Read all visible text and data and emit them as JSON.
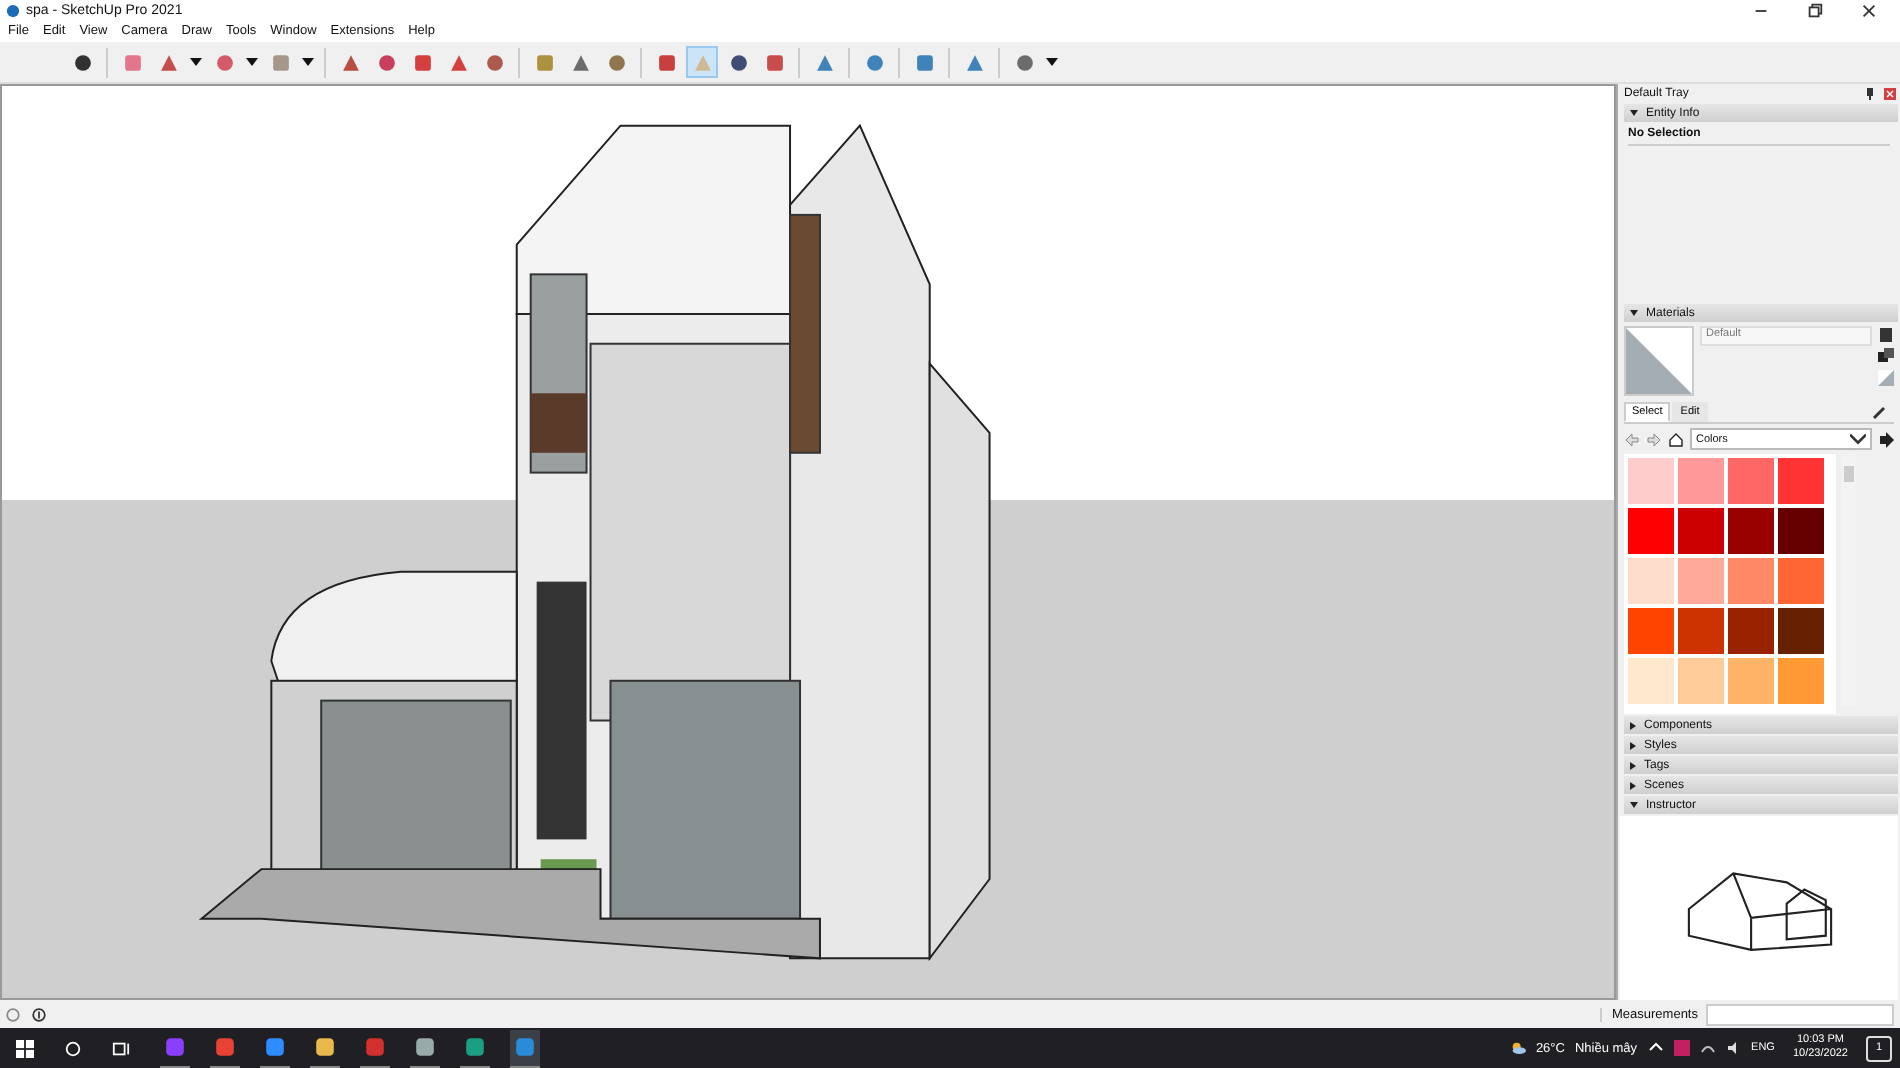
{
  "window": {
    "title": "spa - SketchUp Pro 2021"
  },
  "menu": [
    "File",
    "Edit",
    "View",
    "Camera",
    "Draw",
    "Tools",
    "Window",
    "Extensions",
    "Help"
  ],
  "toolbar": {
    "tools": [
      {
        "selected": false
      },
      {
        "selected": false
      },
      {
        "selected": false
      },
      {
        "selected": false
      },
      {
        "selected": false
      },
      {
        "selected": false
      },
      {
        "selected": false
      },
      {
        "selected": false
      },
      {
        "selected": false
      },
      {
        "selected": false
      },
      {
        "selected": false
      },
      {
        "selected": false
      },
      {
        "selected": false
      },
      {
        "selected": false
      },
      {
        "selected": true
      },
      {
        "selected": false
      },
      {
        "selected": false
      },
      {
        "selected": false
      },
      {
        "selected": false
      },
      {
        "selected": false
      },
      {
        "selected": false
      },
      {
        "selected": false
      }
    ]
  },
  "tray": {
    "title": "Default Tray",
    "panels": [
      {
        "kind": "entity",
        "title": "Entity Info",
        "expanded": true,
        "text": "No Selection"
      },
      {
        "kind": "materials",
        "title": "Materials",
        "expanded": true,
        "material_name": "Default",
        "tabs": [
          {
            "label": "Select",
            "selected": true
          },
          {
            "label": "Edit",
            "selected": false
          }
        ],
        "library": "Colors",
        "swatches": [
          {
            "color": "#ffcccc"
          },
          {
            "color": "#ff9999"
          },
          {
            "color": "#ff6666"
          },
          {
            "color": "#ff3333"
          },
          {
            "color": "#ff0000"
          },
          {
            "color": "#cc0000"
          },
          {
            "color": "#990000"
          },
          {
            "color": "#660000"
          },
          {
            "color": "#ffddcc"
          },
          {
            "color": "#ffaa99"
          },
          {
            "color": "#ff8866"
          },
          {
            "color": "#ff6633"
          },
          {
            "color": "#ff4400"
          },
          {
            "color": "#cc3300"
          },
          {
            "color": "#992200"
          },
          {
            "color": "#662200"
          },
          {
            "color": "#ffe8cc"
          },
          {
            "color": "#ffcc99"
          },
          {
            "color": "#ffb366"
          },
          {
            "color": "#ff9933"
          }
        ]
      },
      {
        "title": "Components",
        "expanded": false
      },
      {
        "title": "Styles",
        "expanded": false
      },
      {
        "title": "Tags",
        "expanded": false
      },
      {
        "title": "Scenes",
        "expanded": false
      },
      {
        "kind": "instructor",
        "title": "Instructor",
        "expanded": true
      }
    ]
  },
  "status_bar": {
    "measurements_label": "Measurements"
  },
  "taskbar": {
    "temperature": "26°C",
    "weather": "Nhiều mây",
    "language": "ENG",
    "time": "10:03 PM",
    "date": "10/23/2022",
    "notifications": "1"
  }
}
